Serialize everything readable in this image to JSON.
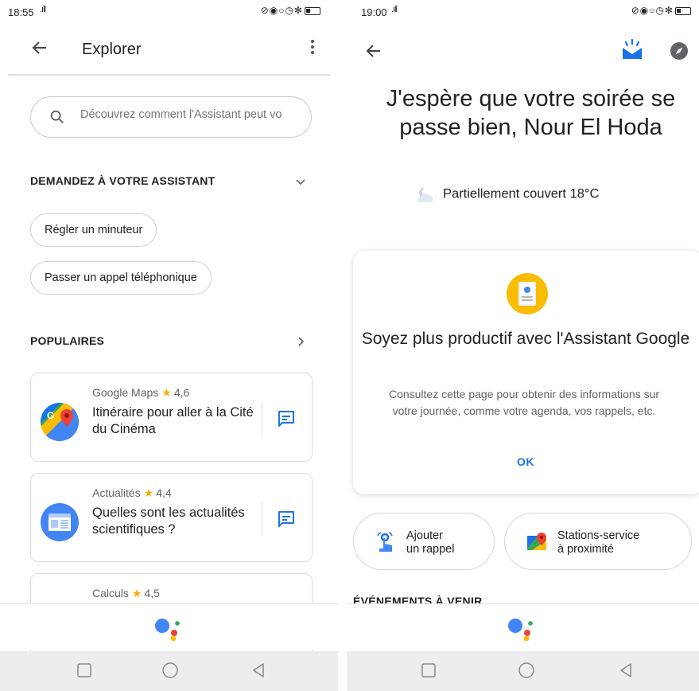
{
  "left": {
    "status": {
      "time": "18:55",
      "signal": ".ıll"
    },
    "title": "Explorer",
    "search_placeholder": "Découvrez comment l'Assistant peut vo",
    "ask_section": {
      "heading": "DEMANDEZ À VOTRE ASSISTANT",
      "chips": [
        "Régler un minuteur",
        "Passer un appel téléphonique"
      ]
    },
    "popular_section": {
      "heading": "POPULAIRES",
      "cards": [
        {
          "app": "Google Maps",
          "star": "★",
          "rating": "4,6",
          "query": "Itinéraire pour aller à la Cité du Cinéma",
          "icon": "google-maps-icon"
        },
        {
          "app": "Actualités",
          "star": "★",
          "rating": "4,4",
          "query": "Quelles sont les actualités scientifiques ?",
          "icon": "news-icon"
        },
        {
          "app": "Calculs",
          "star": "★",
          "rating": "4,5",
          "query": "",
          "icon": "calculator-icon"
        }
      ]
    }
  },
  "right": {
    "status": {
      "time": "19:00",
      "signal": ".ıll"
    },
    "greeting": "J'espère que votre soirée se passe bien, Nour El Hoda",
    "weather": "Partiellement couvert 18°C",
    "promo": {
      "title": "Soyez plus productif avec l'Assistant Google",
      "body": "Consultez cette page pour obtenir des informations sur votre journée, comme votre agenda, vos rappels, etc.",
      "ok": "OK"
    },
    "chips": [
      {
        "label1": "Ajouter",
        "label2": "un rappel",
        "icon": "reminder-icon"
      },
      {
        "label1": "Stations-service",
        "label2": "à proximité",
        "icon": "google-maps-icon"
      }
    ],
    "events_heading": "ÉVÉNEMENTS À VENIR"
  },
  "colors": {
    "google_blue": "#4285f4",
    "google_red": "#ea4335",
    "google_yellow": "#fbbc04",
    "google_green": "#34a853",
    "star": "#f9ab00",
    "link": "#1a73e8"
  }
}
